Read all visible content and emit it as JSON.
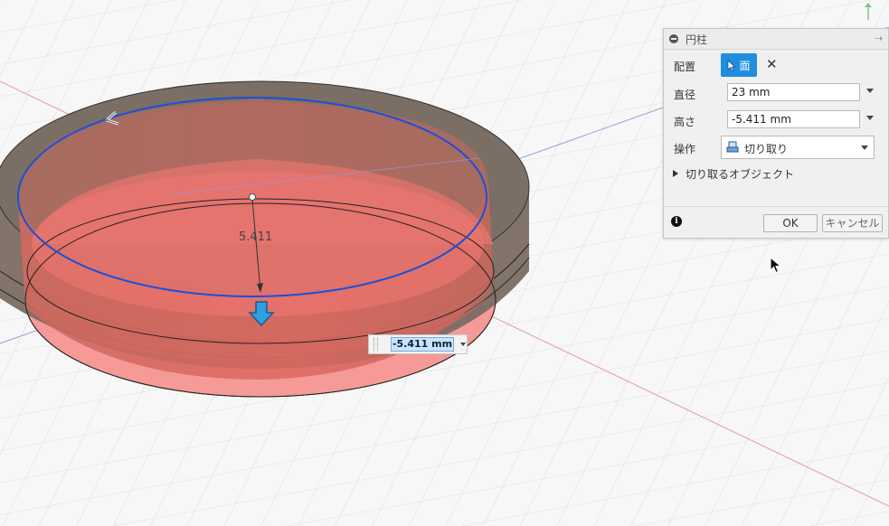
{
  "dialog": {
    "title": "円柱",
    "placement": {
      "label": "配置",
      "selection": "面"
    },
    "diameter": {
      "label": "直径",
      "value": "23 mm"
    },
    "height": {
      "label": "高さ",
      "value": "-5.411 mm"
    },
    "operation": {
      "label": "操作",
      "value": "切り取り",
      "icon": "cut-operation-icon"
    },
    "objects_section": {
      "label": "切り取るオブジェクト",
      "expanded": false
    },
    "ok_label": "OK",
    "cancel_label": "キャンセル"
  },
  "viewport": {
    "height_input": "-5.411 mm",
    "dimension_label": "5.411"
  },
  "colors": {
    "grid": "#d7d7d7",
    "x_axis": "#e07a7a",
    "y_axis": "#8a8ad8",
    "cut_preview": "#f48080",
    "body": "#7d6f65",
    "selection": "#1c4fd8",
    "accent": "#1e8ee0"
  }
}
